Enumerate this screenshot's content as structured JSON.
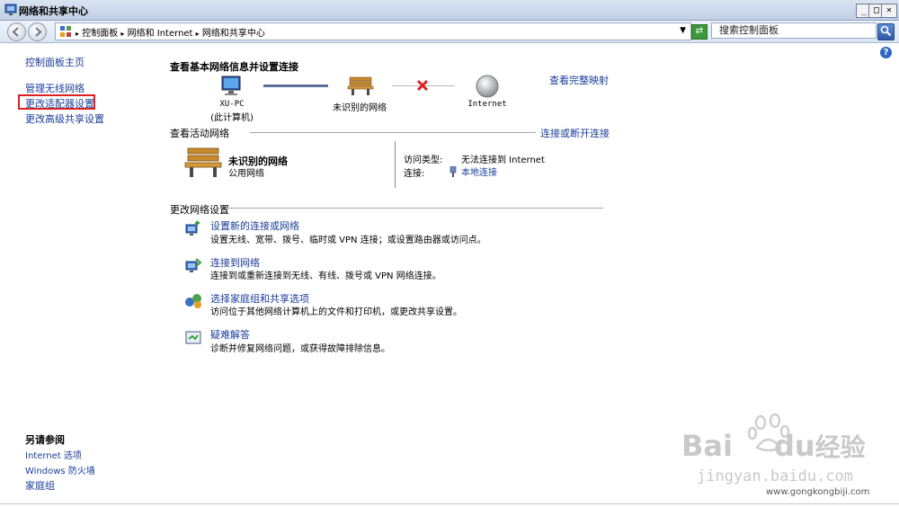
{
  "window": {
    "title": "网络和共享中心"
  },
  "address_bar": {
    "crumbs": [
      "控制面板",
      "网络和 Internet",
      "网络和共享中心"
    ],
    "search_placeholder": "搜索控制面板"
  },
  "left_pane": {
    "items": [
      "控制面板主页",
      "管理无线网络",
      "更改适配器设置",
      "更改高级共享设置"
    ],
    "see_also_title": "另请参阅",
    "see_also": [
      "Internet 选项",
      "Windows 防火墙",
      "家庭组"
    ]
  },
  "main": {
    "heading": "查看基本网络信息并设置连接",
    "view_full_map": "查看完整映射",
    "map": {
      "computer_name": "XU-PC",
      "computer_sub": "(此计算机)",
      "network": "未识别的网络",
      "internet": "Internet"
    },
    "active": {
      "title": "查看活动网络",
      "connect_link": "连接或断开连接",
      "network_name": "未识别的网络",
      "network_type": "公用网络",
      "access_label": "访问类型:",
      "access_value": "无法连接到 Internet",
      "conn_label": "连接:",
      "conn_value": "本地连接"
    },
    "change_title": "更改网络设置",
    "tasks": [
      {
        "title": "设置新的连接或网络",
        "desc": "设置无线、宽带、拨号、临时或 VPN 连接；或设置路由器或访问点。"
      },
      {
        "title": "连接到网络",
        "desc": "连接到或重新连接到无线、有线、拨号或 VPN 网络连接。"
      },
      {
        "title": "选择家庭组和共享选项",
        "desc": "访问位于其他网络计算机上的文件和打印机，或更改共享设置。"
      },
      {
        "title": "疑难解答",
        "desc": "诊断并修复网络问题，或获得故障排除信息。"
      }
    ]
  },
  "watermark": {
    "brand": "Bai",
    "brand2": "du",
    "brand3": "经验",
    "url1": "jingyan.baidu.com",
    "url2": "www.gongkongbiji.com"
  }
}
